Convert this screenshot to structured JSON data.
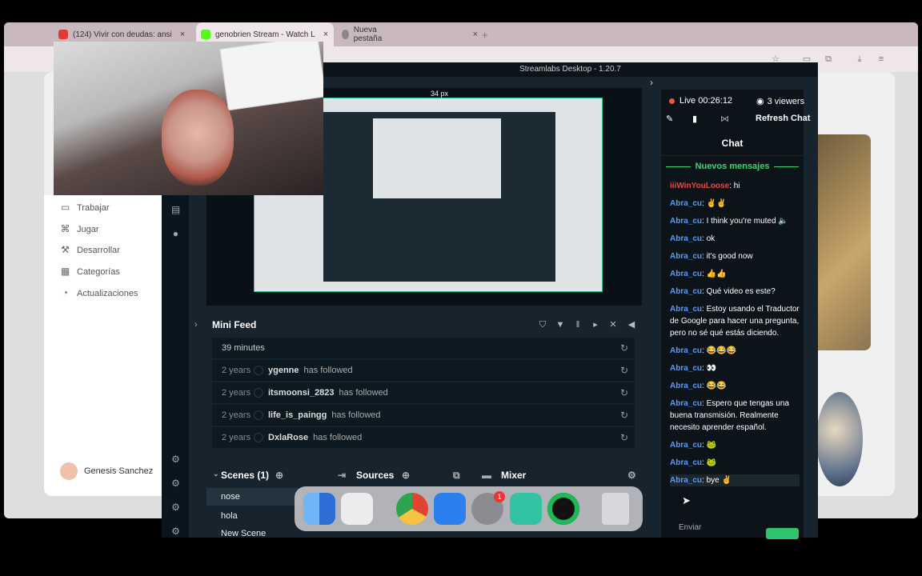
{
  "browser": {
    "tabs": [
      {
        "label": "(124) Vivir con deudas: ansi",
        "icon_color": "#e53935"
      },
      {
        "label": "genobrien Stream - Watch L",
        "icon_color": "#53fc18"
      },
      {
        "label": "Nueva pestaña",
        "icon_color": "#888888"
      }
    ],
    "close_symbol": "×",
    "new_tab_symbol": "+"
  },
  "sidebar": {
    "items": [
      {
        "label": "Trabajar",
        "icon": "briefcase-icon",
        "glyph": "▭"
      },
      {
        "label": "Jugar",
        "icon": "gamepad-icon",
        "glyph": "⌘"
      },
      {
        "label": "Desarrollar",
        "icon": "hammer-icon",
        "glyph": "⚒"
      },
      {
        "label": "Categorías",
        "icon": "grid-icon",
        "glyph": "▦"
      },
      {
        "label": "Actualizaciones",
        "icon": "update-icon",
        "glyph": "◔"
      }
    ],
    "user_name": "Genesis Sanchez"
  },
  "streamlabs": {
    "title": "Streamlabs Desktop - 1.20.7",
    "preview_measure": "34 px",
    "mini_feed": {
      "title": "Mini Feed",
      "first_row": "39 minutes",
      "rows": [
        {
          "ago": "2 years",
          "user": "ygenne",
          "action": "has followed"
        },
        {
          "ago": "2 years",
          "user": "itsmoonsi_2823",
          "action": "has followed"
        },
        {
          "ago": "2 years",
          "user": "life_is_paingg",
          "action": "has followed"
        },
        {
          "ago": "2 years",
          "user": "DxlaRose",
          "action": "has followed"
        }
      ]
    },
    "scenes": {
      "title": "Scenes (1)",
      "items": [
        "nose",
        "hola",
        "New Scene"
      ]
    },
    "sources_title": "Sources",
    "mixer_title": "Mixer"
  },
  "chat": {
    "live_label": "Live 00:26:12",
    "viewers": "3 viewers",
    "refresh": "Refresh Chat",
    "header": "Chat",
    "new_messages": "Nuevos mensajes",
    "send_label": "Enviar",
    "user_color": "#5b9cf0",
    "first_user_color": "#e24a4a",
    "messages": [
      {
        "user": "iiiWinYouLoose",
        "text": ": hi"
      },
      {
        "user": "Abra_cu",
        "text": ": ✌️✌️"
      },
      {
        "user": "Abra_cu",
        "text": ": I think you're muted 🔈"
      },
      {
        "user": "Abra_cu",
        "text": ": ok"
      },
      {
        "user": "Abra_cu",
        "text": ": it's good now"
      },
      {
        "user": "Abra_cu",
        "text": ": 👍👍"
      },
      {
        "user": "Abra_cu",
        "text": ": Qué video es este?"
      },
      {
        "user": "Abra_cu",
        "text": ": Estoy usando el Traductor de Google para hacer una pregunta, pero no sé qué estás diciendo."
      },
      {
        "user": "Abra_cu",
        "text": ": 😂😂😂"
      },
      {
        "user": "Abra_cu",
        "text": ": 👀"
      },
      {
        "user": "Abra_cu",
        "text": ": 😂😂"
      },
      {
        "user": "Abra_cu",
        "text": ": Espero que tengas una buena transmisión. Realmente necesito aprender español."
      },
      {
        "user": "Abra_cu",
        "text": ": 🐸"
      },
      {
        "user": "Abra_cu",
        "text": ": 🐸"
      },
      {
        "user": "Abra_cu",
        "text": ": bye ✌️"
      }
    ]
  },
  "dock": {
    "apps": [
      {
        "name": "finder-icon",
        "color": "#3b8de8"
      },
      {
        "name": "launchpad-icon",
        "color": "#e8e8ea"
      },
      {
        "name": "chrome-icon",
        "color": "#e2452f"
      },
      {
        "name": "app-store-icon",
        "color": "#2d7ff0"
      },
      {
        "name": "system-settings-icon",
        "color": "#8b8b90"
      },
      {
        "name": "streamlabs-icon",
        "color": "#31c3a2"
      },
      {
        "name": "spotify-icon",
        "color": "#1db954"
      },
      {
        "name": "trash-icon",
        "color": "#d8d8dc"
      }
    ],
    "badge": "1"
  }
}
